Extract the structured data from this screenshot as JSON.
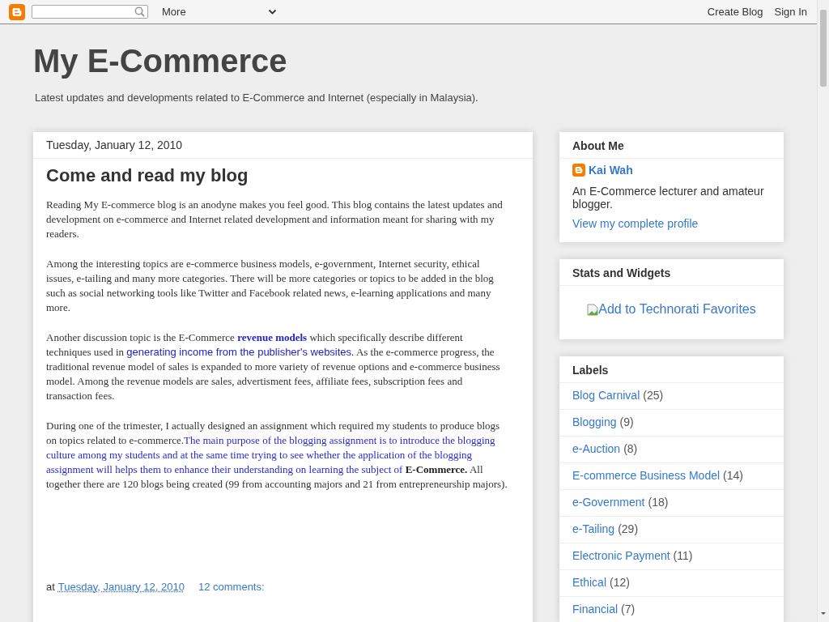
{
  "navbar": {
    "menu": "More",
    "links": [
      "Create Blog",
      "Sign In"
    ]
  },
  "blog": {
    "title": "My E-Commerce",
    "description": "Latest updates and developments related to E-Commerce and Internet (especially in Malaysia)."
  },
  "post": {
    "date_header": "Tuesday, January 12, 2010",
    "title": "Come and read my blog",
    "paragraphs": [
      [
        {
          "kind": "plain",
          "text": "Reading My E-commerce blog is an anodyne makes you feel good. This blog contains the latest updates and development on e-commerce and Internet related development and information meant for sharing with my readers."
        }
      ],
      [
        {
          "kind": "plain",
          "text": "Among the interesting topics are e-commerce business models, e-government, Internet security, ethical issues, e-tailing and many more categories. There will be more categories or topics to be added in the blog such as social networking tools like Twitter and Facebook related news, e-learning applications and many more."
        }
      ],
      [
        {
          "kind": "plain",
          "text": "Another discussion topic is the E-Commerce "
        },
        {
          "kind": "bold-link",
          "text": "revenue models"
        },
        {
          "kind": "plain",
          "text": " which specifically describe different techniques used in "
        },
        {
          "kind": "sans-link",
          "text": "generating income from the publisher's websites"
        },
        {
          "kind": "plain",
          "text": ". As the e-commerce progress, the traditional revenue model of sales is expanded to more variety of revenue options and e-commerce business model. Among the revenue models are sales, advertisment fees, affiliate fees, subscription fees and transaction fees."
        }
      ],
      [
        {
          "kind": "plain",
          "text": "During one of the trimester, I actually designed an assignment which required my students to produce blogs on topics related to e-commerce."
        },
        {
          "kind": "highlight",
          "text": "The main purpose of the blogging assignment is to introduce the blogging culture among my students and at the same time trying to see whether the application of the blogging assignment will helps them to enhance their understanding on learning the subject of **E-Commerce.**"
        },
        {
          "kind": "plain",
          "text": " All together there are 120 blogs being created (99 from accounting majors and 21 from entrepreneurship majors)."
        }
      ]
    ],
    "footer": {
      "prefix": "at",
      "timestamp": "Tuesday, January 12, 2010",
      "comments": "12 comments:"
    }
  },
  "sidebar": {
    "about": {
      "title": "About Me",
      "name": "Kai Wah",
      "bio": "An E-Commerce lecturer and amateur blogger.",
      "profile_link": "View my complete profile"
    },
    "stats": {
      "title": "Stats and Widgets",
      "image_alt": "Add to Technorati Favorites"
    },
    "labels": {
      "title": "Labels",
      "items": [
        {
          "name": "Blog Carnival",
          "count": "(25)"
        },
        {
          "name": "Blogging",
          "count": "(9)"
        },
        {
          "name": "e-Auction",
          "count": "(8)"
        },
        {
          "name": "E-commerce Business Model",
          "count": "(14)"
        },
        {
          "name": "e-Government",
          "count": "(18)"
        },
        {
          "name": "e-Tailing",
          "count": "(29)"
        },
        {
          "name": "Electronic Payment",
          "count": "(11)"
        },
        {
          "name": "Ethical",
          "count": "(12)"
        },
        {
          "name": "Financial",
          "count": "(7)"
        }
      ]
    }
  }
}
